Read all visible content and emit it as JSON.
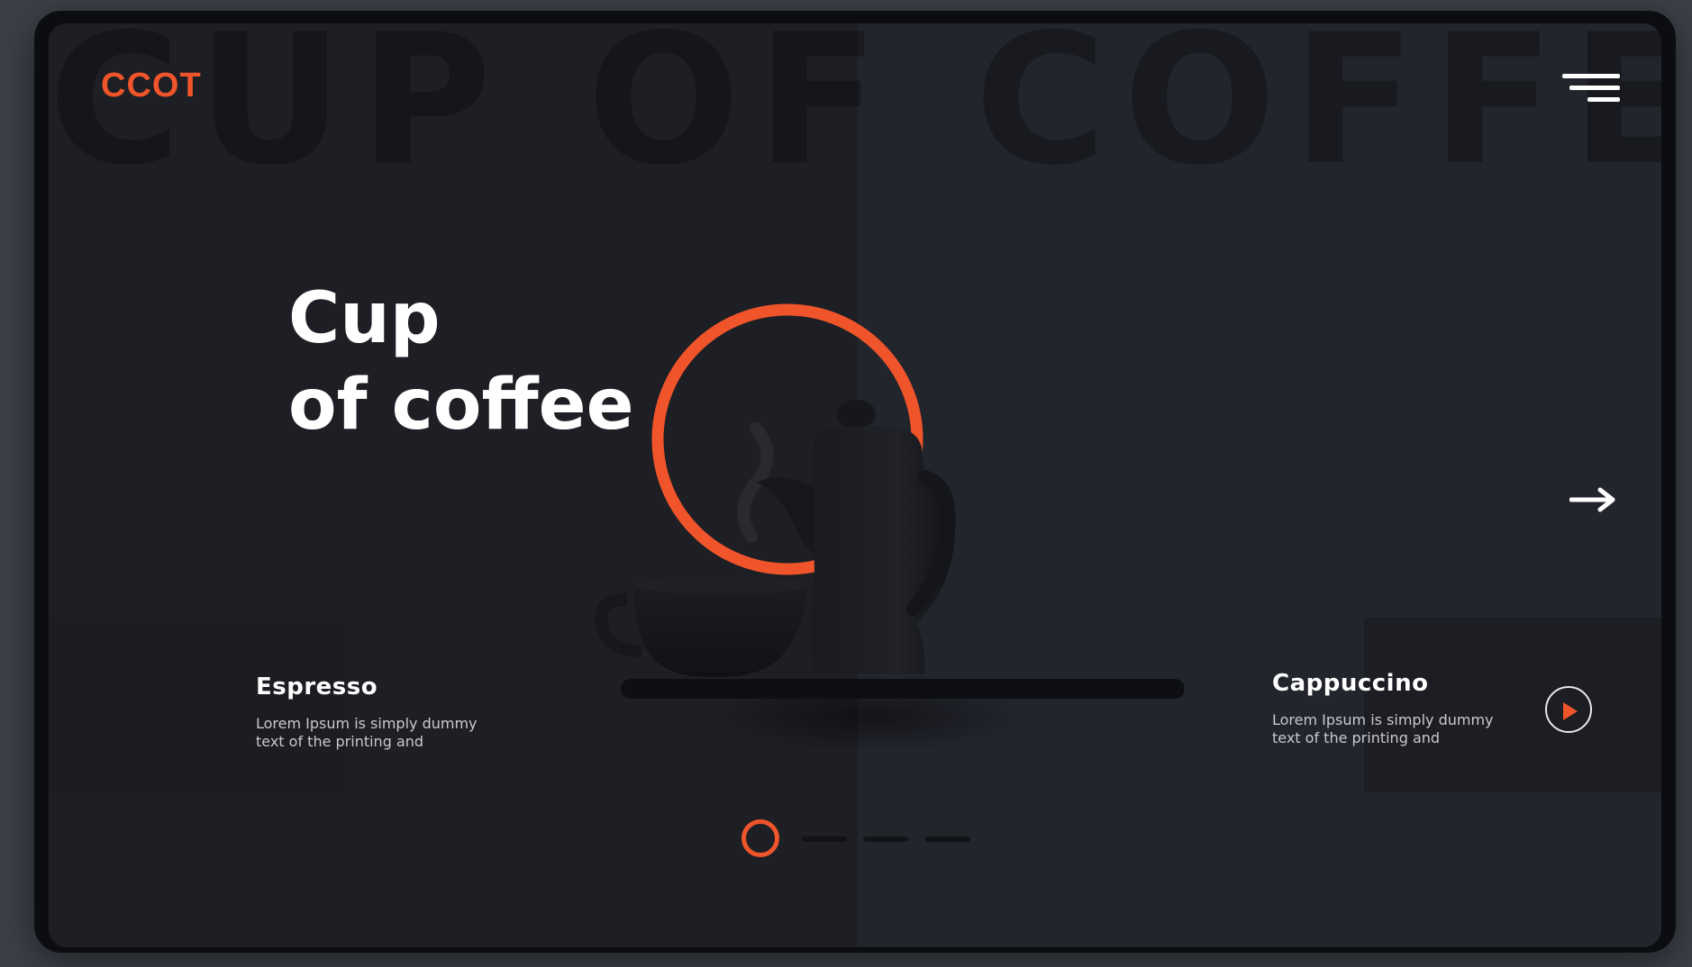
{
  "background_title": "CUP OF COFFEE",
  "brand": {
    "logo_text": "CCOT",
    "accent_color": "#f0542b"
  },
  "hero": {
    "title_line1": "Cup",
    "title_line2": "of coffee"
  },
  "cards": [
    {
      "title": "Espresso",
      "text_line1": "Lorem Ipsum is simply dummy",
      "text_line2": "text of the printing and"
    },
    {
      "title": "Cappuccino",
      "text_line1": "Lorem Ipsum is simply dummy",
      "text_line2": "text of the printing and"
    }
  ],
  "icons": {
    "menu": "hamburger-menu-icon",
    "next": "arrow-right-icon",
    "play": "play-icon"
  },
  "pagination": {
    "total_pages": 4,
    "active_page": 1
  }
}
